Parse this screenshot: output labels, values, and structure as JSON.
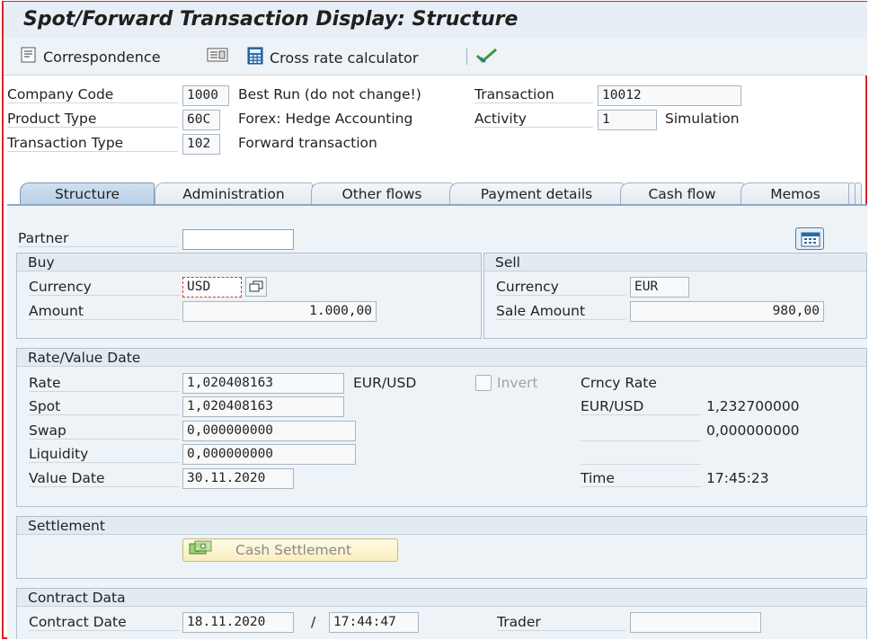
{
  "window": {
    "title": "Spot/Forward Transaction Display: Structure"
  },
  "toolbar": {
    "correspondence_label": "Correspondence",
    "cross_rate_label": "Cross rate calculator"
  },
  "header": {
    "company_code": {
      "label": "Company Code",
      "value": "1000",
      "text": "Best Run (do not change!)"
    },
    "product_type": {
      "label": "Product Type",
      "value": "60C",
      "text": "Forex: Hedge Accounting"
    },
    "transaction_type": {
      "label": "Transaction Type",
      "value": "102",
      "text": "Forward transaction"
    },
    "transaction": {
      "label": "Transaction",
      "value": "10012"
    },
    "activity": {
      "label": "Activity",
      "value": "1",
      "text": "Simulation"
    }
  },
  "tabs": [
    {
      "label": "Structure"
    },
    {
      "label": "Administration"
    },
    {
      "label": "Other flows"
    },
    {
      "label": "Payment details"
    },
    {
      "label": "Cash flow"
    },
    {
      "label": "Memos"
    }
  ],
  "partner": {
    "label": "Partner",
    "value": ""
  },
  "buy": {
    "title": "Buy",
    "currency_label": "Currency",
    "currency_value": "USD",
    "amount_label": "Amount",
    "amount_value": "1.000,00"
  },
  "sell": {
    "title": "Sell",
    "currency_label": "Currency",
    "currency_value": "EUR",
    "amount_label": "Sale Amount",
    "amount_value": "980,00"
  },
  "rate_value": {
    "title": "Rate/Value Date",
    "rate_label": "Rate",
    "rate_value": "1,020408163",
    "rate_unit": "EUR/USD",
    "invert_label": "Invert",
    "spot_label": "Spot",
    "spot_value": "1,020408163",
    "swap_label": "Swap",
    "swap_value": "0,000000000",
    "liquidity_label": "Liquidity",
    "liquidity_value": "0,000000000",
    "value_date_label": "Value Date",
    "value_date_value": "30.11.2020",
    "crncy_rate_label": "Crncy Rate",
    "crncy_pair": "EUR/USD",
    "crncy_rate_value": "1,232700000",
    "crncy_rate_value2": "0,000000000",
    "time_label": "Time",
    "time_value": "17:45:23"
  },
  "settlement": {
    "title": "Settlement",
    "button_label": "Cash Settlement"
  },
  "contract": {
    "title": "Contract Data",
    "date_label": "Contract Date",
    "date_value": "18.11.2020",
    "separator": "/",
    "time_value": "17:44:47",
    "trader_label": "Trader",
    "trader_value": ""
  }
}
